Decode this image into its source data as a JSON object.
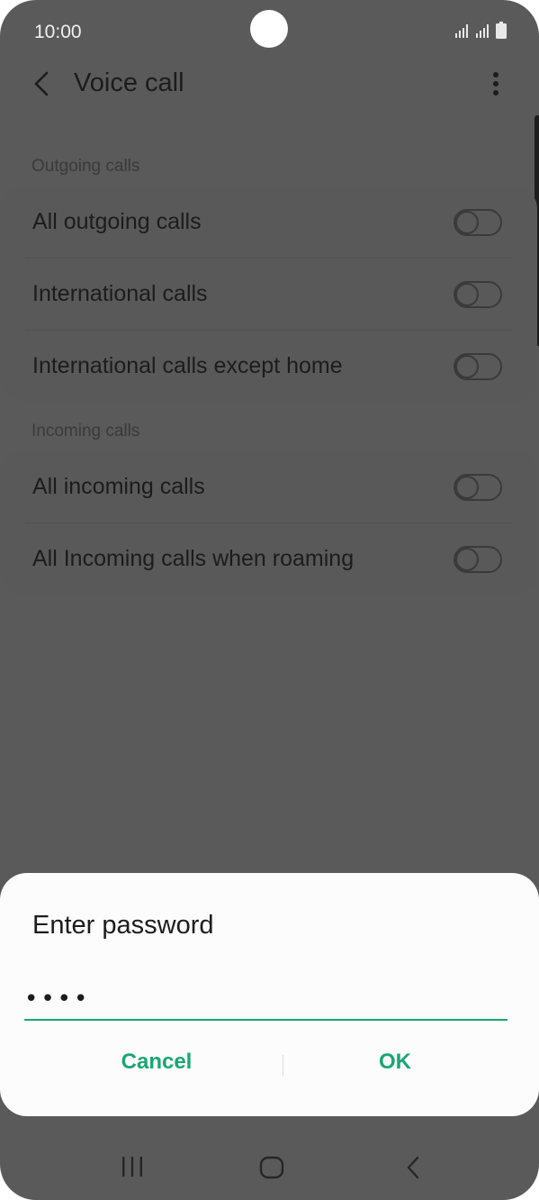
{
  "status_bar": {
    "time": "10:00",
    "icons": [
      "signal-icon",
      "signal-icon",
      "battery-icon"
    ]
  },
  "app_bar": {
    "title": "Voice call",
    "back_icon": "back-arrow-icon",
    "more_icon": "more-options-icon"
  },
  "sections": [
    {
      "header": "Outgoing calls",
      "items": [
        {
          "label": "All outgoing calls",
          "enabled": false
        },
        {
          "label": "International calls",
          "enabled": false
        },
        {
          "label": "International calls except home",
          "enabled": false
        }
      ]
    },
    {
      "header": "Incoming calls",
      "items": [
        {
          "label": "All incoming calls",
          "enabled": false
        },
        {
          "label": "All Incoming calls when roaming",
          "enabled": false
        }
      ]
    }
  ],
  "dialog": {
    "title": "Enter password",
    "password_value": "••••",
    "cancel_label": "Cancel",
    "ok_label": "OK",
    "accent_color": "#1aa673"
  },
  "nav_bar": {
    "icons": [
      "recents-icon",
      "home-icon",
      "back-icon"
    ]
  }
}
